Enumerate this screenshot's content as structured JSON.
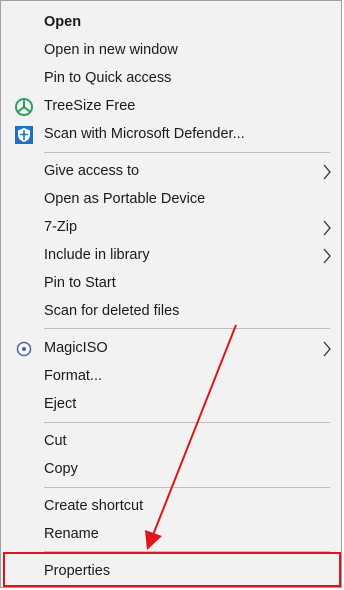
{
  "menu": {
    "items": [
      {
        "label": "Open",
        "icon": "",
        "submenu": false
      },
      {
        "label": "Open in new window",
        "icon": "",
        "submenu": false
      },
      {
        "label": "Pin to Quick access",
        "icon": "",
        "submenu": false
      },
      {
        "label": "TreeSize Free",
        "icon": "treesize-icon",
        "submenu": false
      },
      {
        "label": "Scan with Microsoft Defender...",
        "icon": "defender-shield-icon",
        "submenu": false
      },
      {
        "label": "Give access to",
        "icon": "",
        "submenu": true
      },
      {
        "label": "Open as Portable Device",
        "icon": "",
        "submenu": false
      },
      {
        "label": "7-Zip",
        "icon": "",
        "submenu": true
      },
      {
        "label": "Include in library",
        "icon": "",
        "submenu": true
      },
      {
        "label": "Pin to Start",
        "icon": "",
        "submenu": false
      },
      {
        "label": "Scan for deleted files",
        "icon": "",
        "submenu": false
      },
      {
        "label": "MagicISO",
        "icon": "magiciso-icon",
        "submenu": true
      },
      {
        "label": "Format...",
        "icon": "",
        "submenu": false
      },
      {
        "label": "Eject",
        "icon": "",
        "submenu": false
      },
      {
        "label": "Cut",
        "icon": "",
        "submenu": false
      },
      {
        "label": "Copy",
        "icon": "",
        "submenu": false
      },
      {
        "label": "Create shortcut",
        "icon": "",
        "submenu": false
      },
      {
        "label": "Rename",
        "icon": "",
        "submenu": false
      },
      {
        "label": "Properties",
        "icon": "",
        "submenu": false
      }
    ]
  },
  "annotation": {
    "color": "#e0141b",
    "highlighted_item": "Properties"
  },
  "colors": {
    "menu_background": "#f2f2f2",
    "treesize_green": "#2e9e5b",
    "defender_blue": "#1f6fc4"
  }
}
